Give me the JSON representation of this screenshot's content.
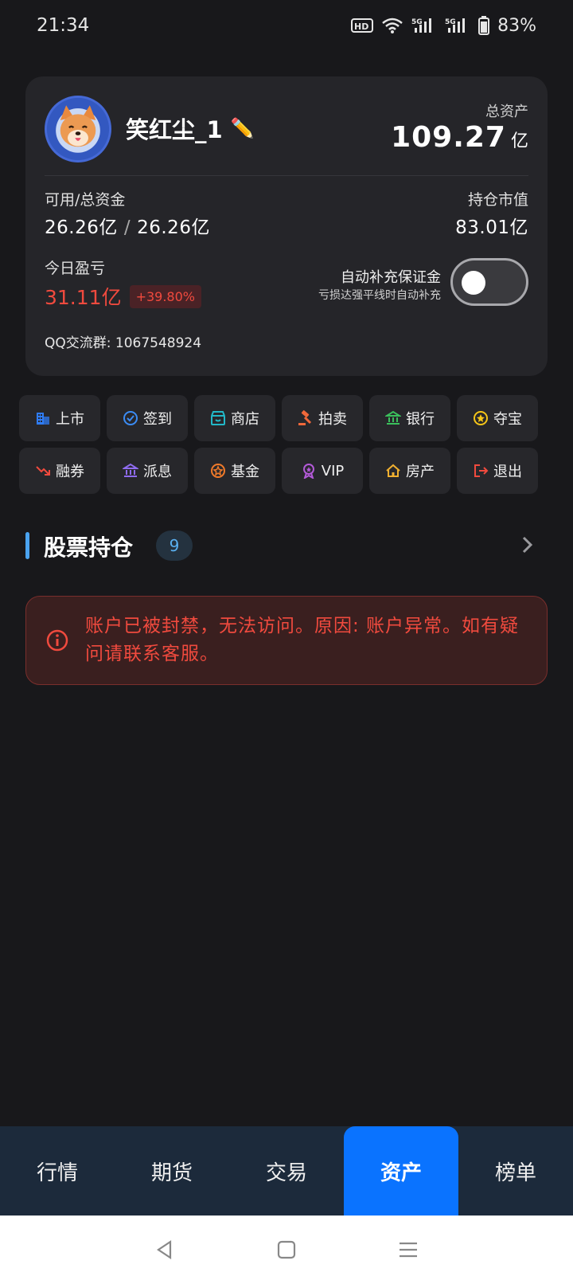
{
  "status": {
    "time": "21:34",
    "battery": "83%",
    "hd": "HD",
    "net1": "5G",
    "net2": "5G"
  },
  "card": {
    "username": "笑红尘_1",
    "edit_icon": "✏️",
    "total_label": "总资产",
    "total_value": "109.27",
    "total_unit": "亿",
    "avail_label": "可用/总资金",
    "avail_value": "26.26亿",
    "total_funds_value": "26.26亿",
    "holding_label": "持仓市值",
    "holding_value": "83.01亿",
    "pnl_label": "今日盈亏",
    "pnl_value": "31.11亿",
    "pnl_pct": "+39.80%",
    "auto_title": "自动补充保证金",
    "auto_sub": "亏损达强平线时自动补充",
    "auto_enabled": false,
    "qq": "QQ交流群: 1067548924"
  },
  "functions": [
    {
      "label": "上市",
      "icon": "building-icon",
      "color": "#2f7cf6"
    },
    {
      "label": "签到",
      "icon": "check-circle-icon",
      "color": "#3b8cf5"
    },
    {
      "label": "商店",
      "icon": "shop-icon",
      "color": "#22b8c8"
    },
    {
      "label": "拍卖",
      "icon": "gavel-icon",
      "color": "#f0683a"
    },
    {
      "label": "银行",
      "icon": "bank-icon",
      "color": "#3bbf5c"
    },
    {
      "label": "夺宝",
      "icon": "star-coin-icon",
      "color": "#f5c518"
    },
    {
      "label": "融券",
      "icon": "trend-down-icon",
      "color": "#f04a3e"
    },
    {
      "label": "派息",
      "icon": "bank-icon",
      "color": "#8f6cf0"
    },
    {
      "label": "基金",
      "icon": "star-circle-icon",
      "color": "#f07a2a"
    },
    {
      "label": "VIP",
      "icon": "medal-icon",
      "color": "#b35ad8"
    },
    {
      "label": "房产",
      "icon": "house-icon",
      "color": "#f0b030"
    },
    {
      "label": "退出",
      "icon": "logout-icon",
      "color": "#f04a3e"
    }
  ],
  "holdings": {
    "title": "股票持仓",
    "count": "9"
  },
  "alert": {
    "text": "账户已被封禁，无法访问。原因: 账户异常。如有疑问请联系客服。"
  },
  "nav": [
    {
      "label": "行情",
      "active": false
    },
    {
      "label": "期货",
      "active": false
    },
    {
      "label": "交易",
      "active": false
    },
    {
      "label": "资产",
      "active": true
    },
    {
      "label": "榜单",
      "active": false
    }
  ],
  "colors": {
    "accent": "#0a73ff",
    "loss_red": "#f04a3e",
    "bg": "#18181b",
    "card": "#252529"
  }
}
